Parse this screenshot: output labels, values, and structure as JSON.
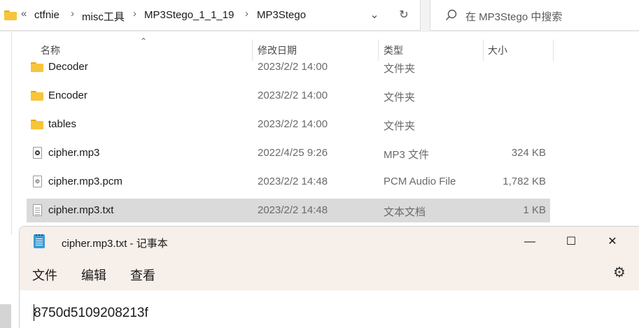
{
  "explorer": {
    "address": {
      "overflow_glyph": "«",
      "crumbs": [
        "ctfnie",
        "misc工具",
        "MP3Stego_1_1_19",
        "MP3Stego"
      ],
      "separator": "›",
      "dropdown_glyph": "⌄",
      "refresh_glyph": "↻"
    },
    "search": {
      "placeholder": "在 MP3Stego 中搜索"
    },
    "columns": {
      "name": "名称",
      "modified": "修改日期",
      "type": "类型",
      "size": "大小",
      "sort_glyph": "⌃"
    },
    "files": [
      {
        "name": "Decoder",
        "modified": "2023/2/2 14:00",
        "type": "文件夹",
        "size": "",
        "icon": "folder-icon"
      },
      {
        "name": "Encoder",
        "modified": "2023/2/2 14:00",
        "type": "文件夹",
        "size": "",
        "icon": "folder-icon"
      },
      {
        "name": "tables",
        "modified": "2023/2/2 14:00",
        "type": "文件夹",
        "size": "",
        "icon": "folder-icon"
      },
      {
        "name": "cipher.mp3",
        "modified": "2022/4/25 9:26",
        "type": "MP3 文件",
        "size": "324 KB",
        "icon": "mp3-file-icon"
      },
      {
        "name": "cipher.mp3.pcm",
        "modified": "2023/2/2 14:48",
        "type": "PCM Audio File",
        "size": "1,782 KB",
        "icon": "pcm-file-icon"
      },
      {
        "name": "cipher.mp3.txt",
        "modified": "2023/2/2 14:48",
        "type": "文本文档",
        "size": "1 KB",
        "icon": "text-file-icon",
        "selected": true
      }
    ]
  },
  "notepad": {
    "title": "cipher.mp3.txt - 记事本",
    "window_controls": {
      "minimize": "—",
      "maximize": "☐",
      "close": "✕"
    },
    "menu": [
      "文件",
      "编辑",
      "查看"
    ],
    "settings_glyph": "⚙",
    "content": "8750d5109208213f"
  },
  "colors": {
    "folder": "#f8c43a",
    "selection": "#dadada",
    "titlebar": "#f7efea",
    "notepad_icon": "#3b9bd6"
  }
}
